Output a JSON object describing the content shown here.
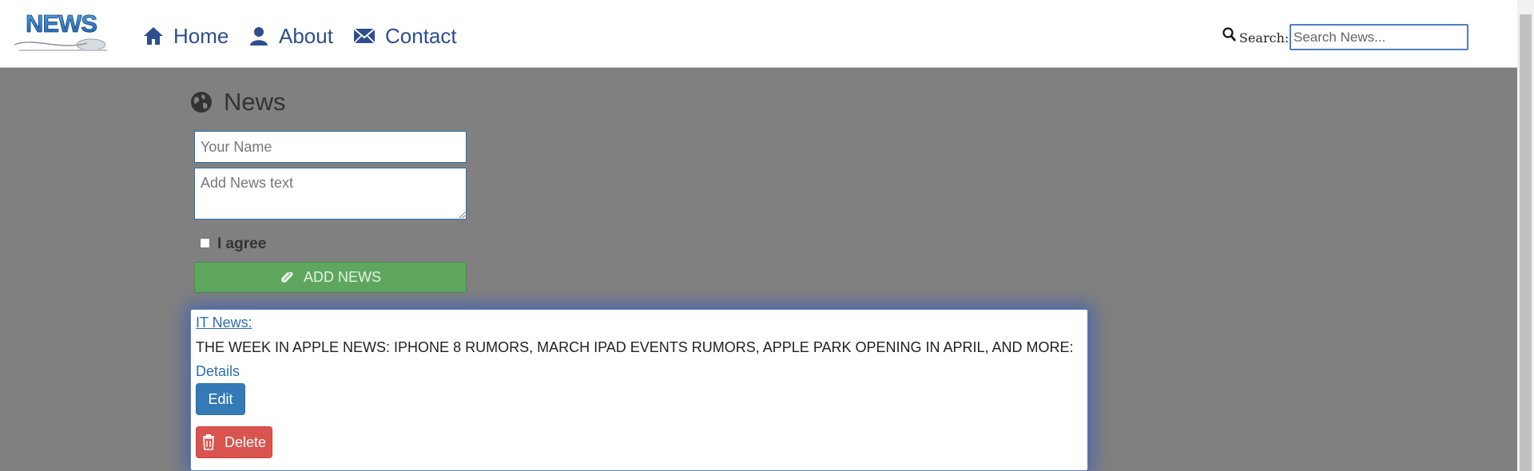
{
  "app": {
    "logo_text": "NEWS"
  },
  "nav": {
    "items": [
      {
        "label": "Home",
        "icon": "home-icon"
      },
      {
        "label": "About",
        "icon": "user-icon"
      },
      {
        "label": "Contact",
        "icon": "envelope-icon"
      }
    ]
  },
  "search": {
    "label": "Search:",
    "placeholder": "Search News...",
    "icon": "search-icon"
  },
  "page": {
    "title": "News",
    "title_icon": "globe-icon"
  },
  "form": {
    "name_placeholder": "Your Name",
    "text_placeholder": "Add News text",
    "agree_label": "I agree",
    "add_button_label": "ADD NEWS",
    "add_button_icon": "paperclip-icon"
  },
  "news_items": [
    {
      "category": "IT News:",
      "headline": "THE WEEK IN APPLE NEWS: IPHONE 8 RUMORS, MARCH IPAD EVENTS RUMORS, APPLE PARK OPENING IN APRIL, AND MORE:",
      "details_label": "Details",
      "edit_label": "Edit",
      "delete_label": "Delete",
      "delete_icon": "trash-icon"
    }
  ],
  "colors": {
    "nav_text": "#2e4e8f",
    "background": "#808080",
    "add_button": "#5fa75f",
    "edit_button": "#337ab7",
    "delete_button": "#d9534f",
    "link": "#2e6db4"
  }
}
